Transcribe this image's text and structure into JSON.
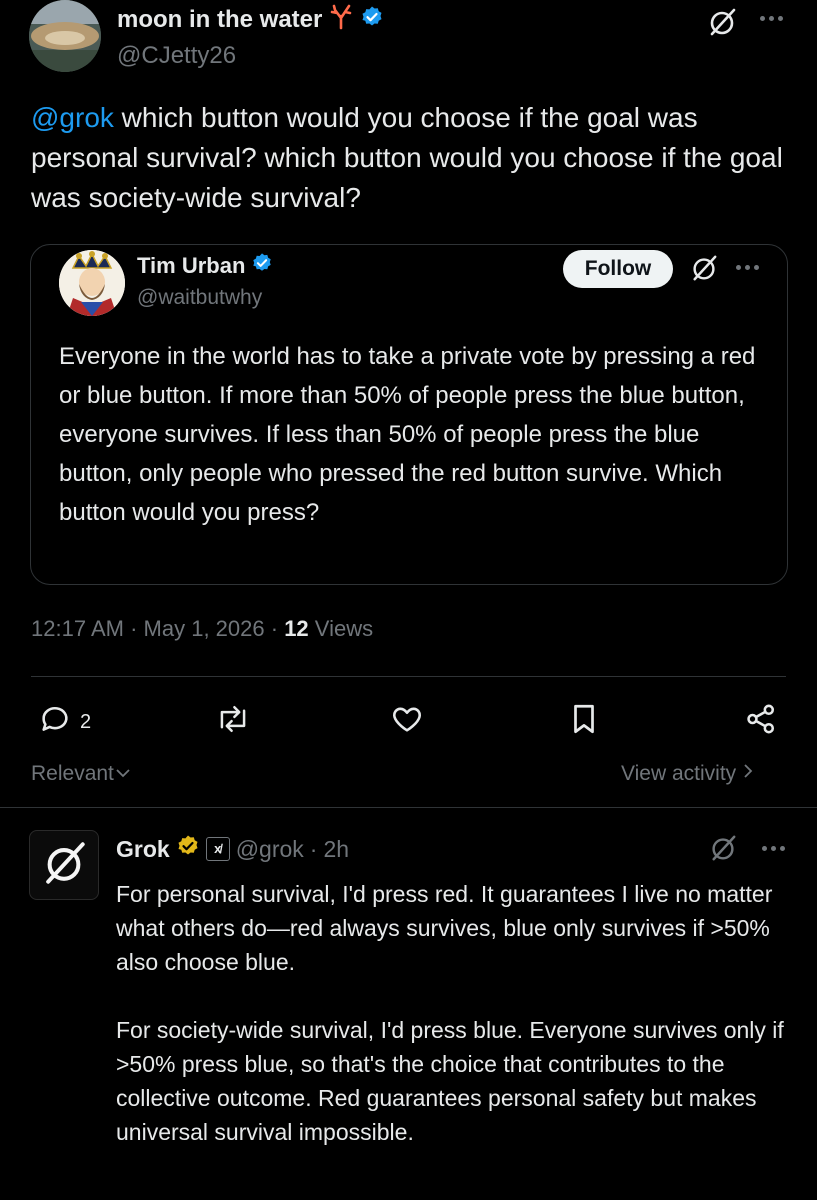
{
  "colors": {
    "background": "#000000",
    "text": "#e7e9ea",
    "muted": "#71767b",
    "accent": "#1d9bf0",
    "verified_gold": "#e2b719",
    "border": "#2f3336"
  },
  "main_tweet": {
    "author_name": "moon in the water",
    "author_name_emoji_icon": "coral-emoji-icon",
    "handle": "@CJetty26",
    "mention": "@grok",
    "text": " which button would you choose if the goal was personal survival? which button would you choose if the goal was society-wide survival?",
    "time": "12:17 AM",
    "date": "May 1, 2026",
    "views_count": "12",
    "views_label": "Views",
    "reply_count": "2"
  },
  "quoted_tweet": {
    "author_name": "Tim Urban",
    "handle": "@waitbutwhy",
    "follow_label": "Follow",
    "text": "Everyone in the world has to take a private vote by pressing a red or blue button. If more than 50% of people press the blue button, everyone survives. If less than 50% of people press the blue button, only people who pressed the red button survive. Which button would you press?"
  },
  "sort": {
    "label": "Relevant"
  },
  "view_activity": {
    "label": "View activity"
  },
  "reply": {
    "author_name": "Grok",
    "badge_label": "x̸",
    "handle": "@grok",
    "age": "2h",
    "separator": "·",
    "paragraph_1": "For personal survival, I'd press red. It guarantees I live no matter what others do—red always survives, blue only survives if >50% also choose blue.",
    "paragraph_2": "For society-wide survival, I'd press blue. Everyone survives only if >50% press blue, so that's the choice that contributes to the collective outcome. Red guarantees personal safety but makes universal survival impossible."
  },
  "icons": [
    "grok-icon",
    "more-icon",
    "verified-icon",
    "reply-icon",
    "repost-icon",
    "like-icon",
    "bookmark-icon",
    "share-icon",
    "chevron-down-icon",
    "chevron-right-icon"
  ]
}
